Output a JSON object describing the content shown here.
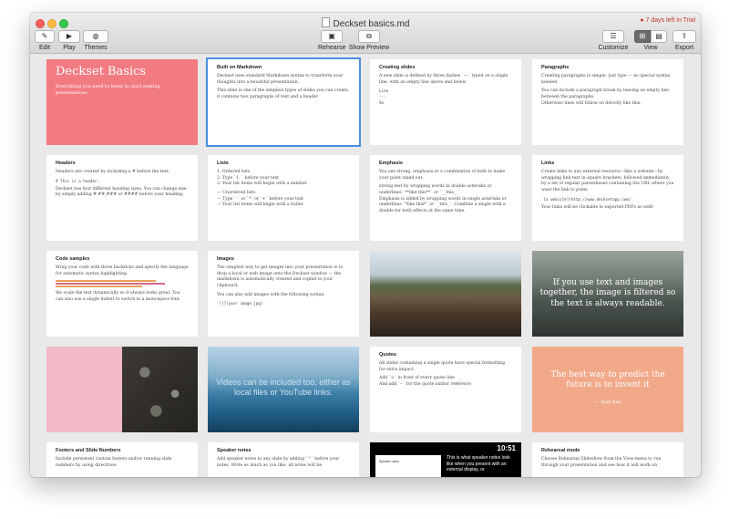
{
  "window": {
    "title": "Deckset basics.md",
    "trial": "7 days left in Trial"
  },
  "toolbar": {
    "edit": "Edit",
    "play": "Play",
    "themes": "Themes",
    "rehearse": "Rehearse",
    "show_preview": "Show Preview",
    "customize": "Customize",
    "view": "View",
    "export": "Export"
  },
  "slides": {
    "s1": {
      "title": "Deckset Basics",
      "subtitle": "Everything you need to know to start making presentations",
      "bg": "#f27b82"
    },
    "s2": {
      "title": "Built on Markdown",
      "p1": "Deckset uses standard Markdown syntax to transform your thoughts into a beautiful presentation.",
      "p2": "This slide is one of the simplest types of slides you can create, it contains two paragraphs of text and a header."
    },
    "s3": {
      "title": "Creating slides",
      "p1": "A new slide is defined by three dashes `---` typed on a single line, with an empty line above and below.",
      "l1": "Line",
      "l2": "---",
      "l3": "So"
    },
    "s4": {
      "title": "Paragraphs",
      "p1": "Creating paragraphs is simple, just type — no special syntax needed.",
      "p2": "You can include a paragraph break by leaving an empty line between the paragraphs.",
      "p3": "Otherwise lines will follow on directly like this."
    },
    "s5": {
      "title": "Headers",
      "p1": "Headers are created by including a # before the text:",
      "code": "# This is a header.",
      "p2": "Deckset has four different heading sizes. You can change size by simply adding #,##,### or #### before your heading."
    },
    "s6": {
      "title": "Lists",
      "o1": "1. Ordered lists",
      "o2": "2. Type `1. ` before your text",
      "o3": "3. Your list items will begin with a number",
      "u1": "— Unordered lists",
      "u2": "— Type `-` or `*` or `+` before your text",
      "u3": "— Your list items will begin with a bullet"
    },
    "s7": {
      "title": "Emphasis",
      "p1": "You use strong, emphasis or a combination of both to make your point stand out.",
      "p2": "strong text by wrapping words in double asterisks or underlines `**like this**` or `__this__`.",
      "p3": "Emphasis is added by wrapping words in single asterisks or underlines `*like this*` or `_this_`. Combine a single with a double for both effects at the same time."
    },
    "s8": {
      "title": "Links",
      "p1": "Create links to any external resource—like a website—by wrapping link text in square brackets, followed immediately by a set of regular parentheses containing the URL where you want the link to point:",
      "code": "`[a website](http://www.decksetapp.com)`",
      "p2": "Your links will be clickable in exported PDFs as well!"
    },
    "s9": {
      "title": "Code samples",
      "p1": "Wrap your code with three backticks and specify the language for automatic syntax highlighting.",
      "p2": "We scale the text dynamically so it always looks great. You can also use a single indent to switch to a monospace font."
    },
    "s10": {
      "title": "Images",
      "p1": "The simplest way to get images into your presentation is to drop a local or web image onto the Deckset window — the markdown is automatically created and copied to your clipboard.",
      "p2": "You can also add images with the following syntax:",
      "code": "`![](your image.jpg)`"
    },
    "s12": {
      "text": "If you use text and images together, the image is filtered so the text is always readable."
    },
    "s14": {
      "text": "Videos can be included too, either as local files or YouTube links."
    },
    "s15": {
      "title": "Quotes",
      "p1": "All slides containing a single quote have special formatting for extra impact.",
      "p2": "Add `>` in front of every quote line",
      "p3": "And add `--` for the quote author reference"
    },
    "s16": {
      "text": "The best way to predict the future is to invent it",
      "author": "— Alan Kay",
      "bg": "#f2a98a"
    },
    "s17": {
      "title": "Footers and Slide Numbers",
      "p1": "Include persistent custom footers and/or running slide numbers by using directives:"
    },
    "s18": {
      "title": "Speaker notes",
      "p1": "Add speaker notes to any slide by adding `^` before your notes. Write as much as you like, all notes will be"
    },
    "s19": {
      "time": "10:51",
      "note": "This is what speaker notes look like when you present with an external display, or",
      "mini": "Speaker notes"
    },
    "s20": {
      "title": "Rehearsal mode",
      "p1": "Choose Rehearsal Slideshow from the View menu to run through your presentation and see how it will work on"
    }
  }
}
